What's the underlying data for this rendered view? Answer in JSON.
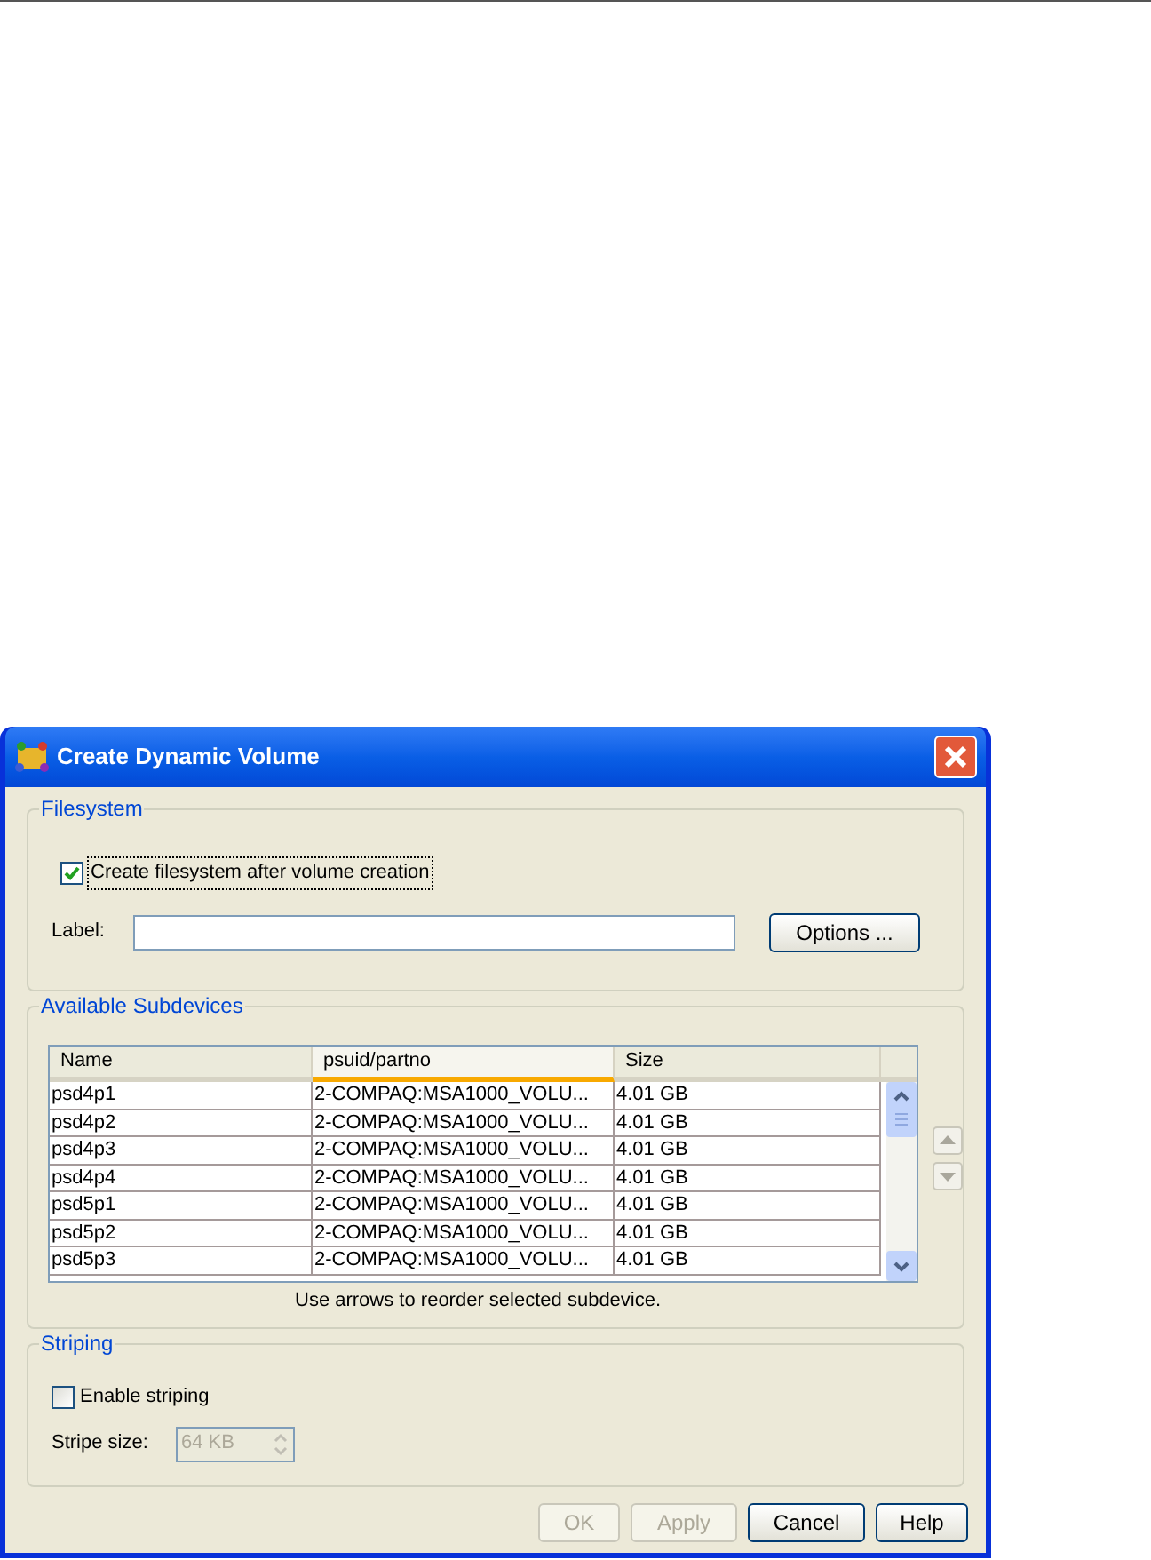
{
  "window": {
    "title": "Create Dynamic Volume"
  },
  "filesystem": {
    "title": "Filesystem",
    "create_checkbox": {
      "label": "Create filesystem after volume creation",
      "checked": true
    },
    "label_field": {
      "label": "Label:"
    },
    "options_button": "Options ..."
  },
  "subdevices": {
    "title": "Available Subdevices",
    "table": {
      "columns": [
        {
          "label": "Name",
          "highlighted": false
        },
        {
          "label": "psuid/partno",
          "highlighted": true
        },
        {
          "label": "Size",
          "highlighted": false
        }
      ],
      "rows": [
        [
          "psd4p1",
          "2-COMPAQ:MSA1000_VOLU...",
          "4.01 GB"
        ],
        [
          "psd4p2",
          "2-COMPAQ:MSA1000_VOLU...",
          "4.01 GB"
        ],
        [
          "psd4p3",
          "2-COMPAQ:MSA1000_VOLU...",
          "4.01 GB"
        ],
        [
          "psd4p4",
          "2-COMPAQ:MSA1000_VOLU...",
          "4.01 GB"
        ],
        [
          "psd5p1",
          "2-COMPAQ:MSA1000_VOLU...",
          "4.01 GB"
        ],
        [
          "psd5p2",
          "2-COMPAQ:MSA1000_VOLU...",
          "4.01 GB"
        ],
        [
          "psd5p3",
          "2-COMPAQ:MSA1000_VOLU...",
          "4.01 GB"
        ]
      ]
    },
    "hint": "Use arrows to reorder selected subdevice."
  },
  "striping": {
    "title": "Striping",
    "enable_checkbox": {
      "label": "Enable striping",
      "checked": false
    },
    "stripe_size": {
      "label": "Stripe size:",
      "value": "64 KB",
      "disabled": true
    }
  },
  "buttons": [
    {
      "label": "OK",
      "disabled": true
    },
    {
      "label": "Apply",
      "disabled": true
    },
    {
      "label": "Cancel",
      "disabled": false
    },
    {
      "label": "Help",
      "disabled": false
    }
  ]
}
